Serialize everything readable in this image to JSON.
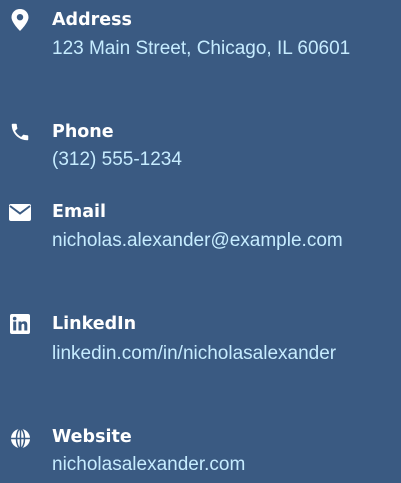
{
  "contact": {
    "items": [
      {
        "label": "Address",
        "value": "123 Main Street, Chicago, IL 60601",
        "icon": "map-marker-icon"
      },
      {
        "label": "Phone",
        "value": "(312) 555-1234",
        "icon": "phone-icon"
      },
      {
        "label": "Email",
        "value": "nicholas.alexander@example.com",
        "icon": "envelope-icon"
      },
      {
        "label": "LinkedIn",
        "value": "linkedin.com/in/nicholasalexander",
        "icon": "linkedin-icon"
      },
      {
        "label": "Website",
        "value": "nicholasalexander.com",
        "icon": "globe-icon"
      }
    ]
  },
  "colors": {
    "background": "#3a5a82",
    "label": "#ffffff",
    "value": "#c6ecff",
    "icon": "#ffffff"
  }
}
